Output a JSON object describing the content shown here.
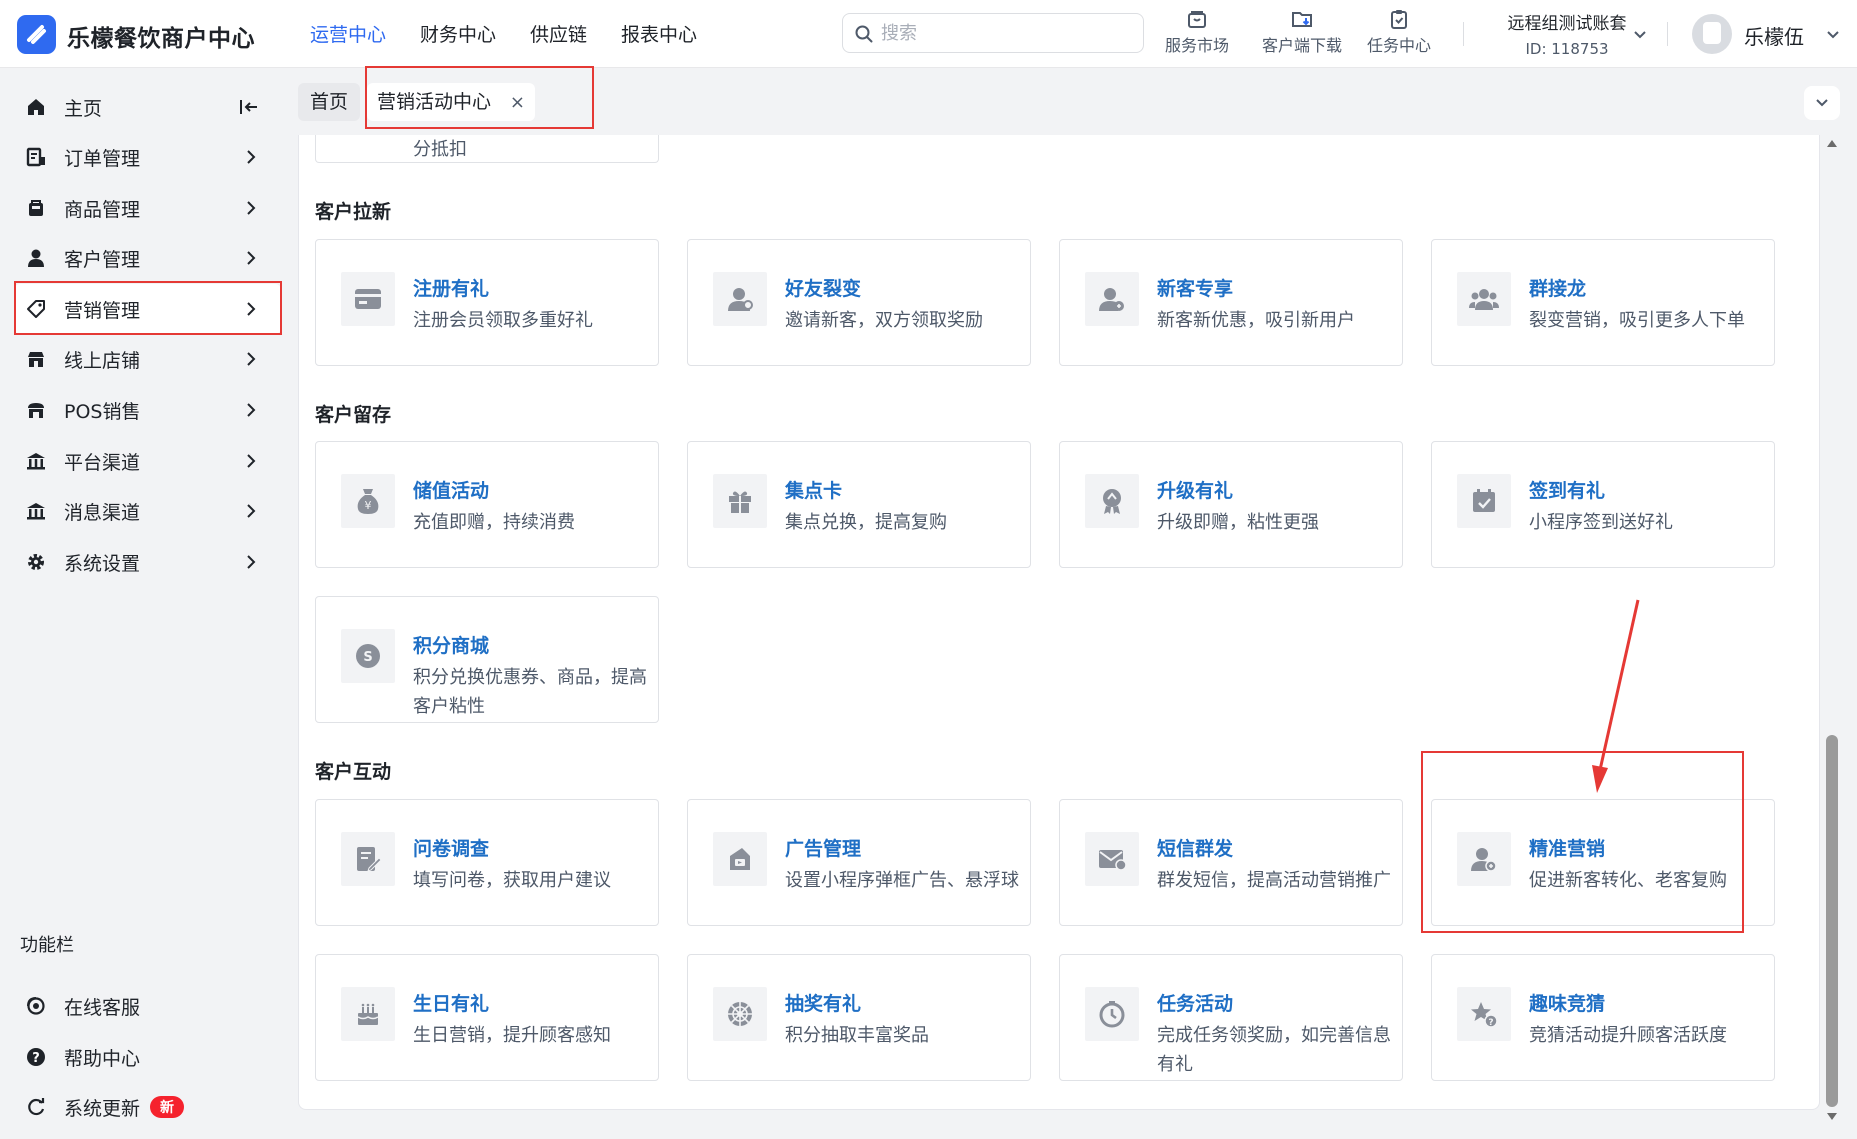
{
  "app": {
    "title": "乐檬餐饮商户中心"
  },
  "nav": [
    {
      "label": "运营中心",
      "active": true
    },
    {
      "label": "财务中心"
    },
    {
      "label": "供应链"
    },
    {
      "label": "报表中心"
    }
  ],
  "search": {
    "placeholder": "搜索",
    "value": ""
  },
  "tools": [
    {
      "label": "服务市场",
      "icon": "store-icon"
    },
    {
      "label": "客户端下载",
      "icon": "download-folder-icon"
    },
    {
      "label": "任务中心",
      "icon": "clipboard-check-icon"
    }
  ],
  "account": {
    "name": "远程组测试账套",
    "id": "ID: 118753"
  },
  "user": {
    "name": "乐檬伍"
  },
  "sidebar": {
    "items": [
      {
        "label": "主页",
        "icon": "home-icon"
      },
      {
        "label": "订单管理",
        "icon": "order-icon"
      },
      {
        "label": "商品管理",
        "icon": "goods-icon"
      },
      {
        "label": "客户管理",
        "icon": "user-icon"
      },
      {
        "label": "营销管理",
        "icon": "tag-icon",
        "selected": true
      },
      {
        "label": "线上店铺",
        "icon": "shop-icon"
      },
      {
        "label": "POS销售",
        "icon": "pos-store-icon"
      },
      {
        "label": "平台渠道",
        "icon": "bank-icon"
      },
      {
        "label": "消息渠道",
        "icon": "bank-icon"
      },
      {
        "label": "系统设置",
        "icon": "gear-icon"
      }
    ],
    "section_label": "功能栏",
    "footer": [
      {
        "label": "在线客服",
        "icon": "headset-icon"
      },
      {
        "label": "帮助中心",
        "icon": "help-icon"
      },
      {
        "label": "系统更新",
        "icon": "refresh-icon",
        "badge": "新"
      }
    ]
  },
  "tabs": {
    "home": "首页",
    "active": "营销活动中心"
  },
  "partial_card_text": "分抵扣",
  "groups": [
    {
      "title": "客户拉新",
      "cards": [
        {
          "title": "注册有礼",
          "desc": "注册会员领取多重好礼",
          "icon": "card-icon"
        },
        {
          "title": "好友裂变",
          "desc": "邀请新客，双方领取奖励",
          "icon": "friend-icon"
        },
        {
          "title": "新客专享",
          "desc": "新客新优惠，吸引新用户",
          "icon": "new-user-icon"
        },
        {
          "title": "群接龙",
          "desc": "裂变营销，吸引更多人下单",
          "icon": "group-icon"
        }
      ]
    },
    {
      "title": "客户留存",
      "cards": [
        {
          "title": "储值活动",
          "desc": "充值即赠，持续消费",
          "icon": "money-bag-icon"
        },
        {
          "title": "集点卡",
          "desc": "集点兑换，提高复购",
          "icon": "gift-icon"
        },
        {
          "title": "升级有礼",
          "desc": "升级即赠，粘性更强",
          "icon": "upgrade-icon"
        },
        {
          "title": "签到有礼",
          "desc": "小程序签到送好礼",
          "icon": "checkin-calendar-icon"
        },
        {
          "title": "积分商城",
          "desc": "积分兑换优惠券、商品，提高客户粘性",
          "icon": "points-coin-icon"
        }
      ]
    },
    {
      "title": "客户互动",
      "cards": [
        {
          "title": "问卷调查",
          "desc": "填写问卷，获取用户建议",
          "icon": "survey-icon"
        },
        {
          "title": "广告管理",
          "desc": "设置小程序弹框广告、悬浮球",
          "icon": "ad-icon"
        },
        {
          "title": "短信群发",
          "desc": "群发短信，提高活动营销推广",
          "icon": "sms-icon"
        },
        {
          "title": "精准营销",
          "desc": "促进新客转化、老客复购",
          "icon": "precise-user-icon"
        },
        {
          "title": "生日有礼",
          "desc": "生日营销，提升顾客感知",
          "icon": "cake-icon"
        },
        {
          "title": "抽奖有礼",
          "desc": "积分抽取丰富奖品",
          "icon": "lottery-wheel-icon"
        },
        {
          "title": "任务活动",
          "desc": "完成任务领奖励，如完善信息有礼",
          "icon": "stopwatch-icon"
        },
        {
          "title": "趣味竞猜",
          "desc": "竞猜活动提升顾客活跃度",
          "icon": "star-quiz-icon"
        }
      ]
    }
  ],
  "colors": {
    "accent": "#2f6af0",
    "card_title": "#1f6fc5",
    "annotation": "#e53935"
  }
}
